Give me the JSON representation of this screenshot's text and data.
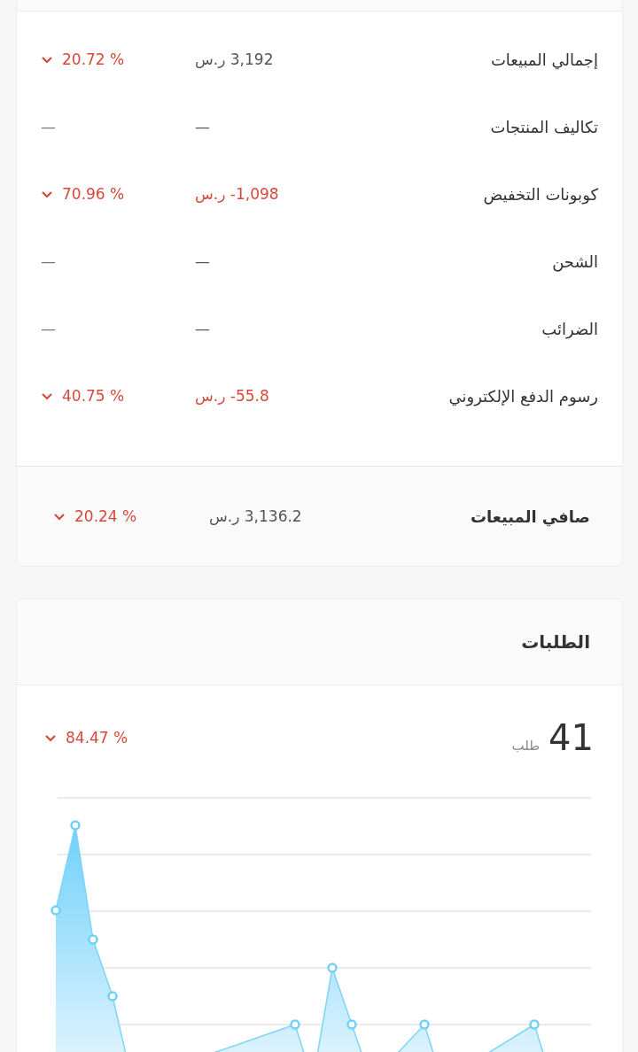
{
  "sales_card": {
    "rows": [
      {
        "label": "إجمالي المبيعات",
        "value": "3,192 ر.س",
        "negative": false,
        "change": "20.72 %",
        "down": true
      },
      {
        "label": "تكاليف المنتجات",
        "value": "—",
        "negative": false,
        "change": "—",
        "down": false
      },
      {
        "label": "كوبونات التخفيض",
        "value": "1,098- ر.س",
        "negative": true,
        "change": "70.96 %",
        "down": true
      },
      {
        "label": "الشحن",
        "value": "—",
        "negative": false,
        "change": "—",
        "down": false
      },
      {
        "label": "الضرائب",
        "value": "—",
        "negative": false,
        "change": "—",
        "down": false
      },
      {
        "label": "رسوم الدفع الإلكتروني",
        "value": "55.8- ر.س",
        "negative": true,
        "change": "40.75 %",
        "down": true
      }
    ],
    "total": {
      "label": "صافي المبيعات",
      "value": "3,136.2 ر.س",
      "change": "20.24 %",
      "down": true
    }
  },
  "orders_card": {
    "title": "الطلبات",
    "count": "41",
    "unit": "طلب",
    "change": "84.47 %",
    "down": true
  }
}
